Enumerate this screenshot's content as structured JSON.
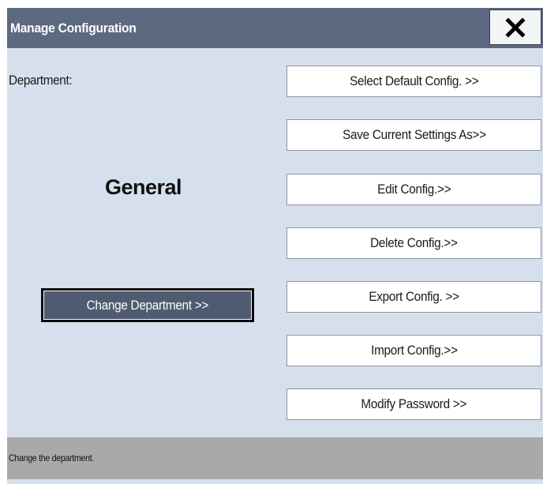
{
  "window": {
    "title": "Manage Configuration",
    "close_icon": "close-icon"
  },
  "department": {
    "label": "Department:",
    "value": "General",
    "change_button": "Change Department >>"
  },
  "menu": {
    "items": [
      {
        "label": "Select Default Config. >>"
      },
      {
        "label": "Save Current Settings As>>"
      },
      {
        "label": "Edit Config.>>"
      },
      {
        "label": "Delete Config.>>"
      },
      {
        "label": "Export Config. >>"
      },
      {
        "label": "Import Config.>>"
      },
      {
        "label": "Modify Password >>"
      }
    ]
  },
  "status": {
    "text": "Change the department."
  },
  "colors": {
    "titlebar": "#5d6980",
    "dialog_background": "#d6e0ec",
    "selected_button": "#4f5b70",
    "status_bar": "#a9a9a9"
  }
}
